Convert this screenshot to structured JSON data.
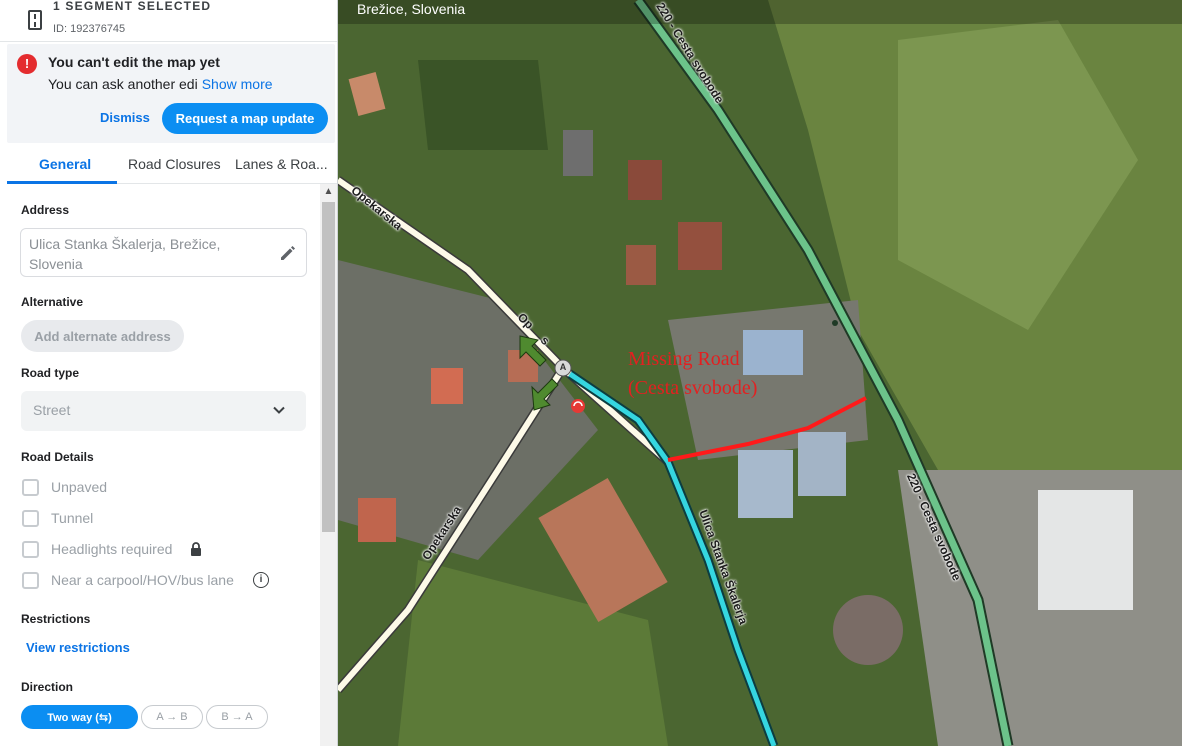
{
  "segment_header": {
    "title": "1 SEGMENT SELECTED",
    "id_text": "ID: 192376745"
  },
  "alert": {
    "icon": "!",
    "title": "You can't edit the map yet",
    "body": "You can ask another edi",
    "more_link": "Show more",
    "dismiss_label": "Dismiss",
    "request_label": "Request a map update"
  },
  "tabs": {
    "general": "General",
    "closures": "Road Closures",
    "lanes": "Lanes & Roa..."
  },
  "form": {
    "address_label": "Address",
    "address_value": "Ulica Stanka Škalerja, Brežice, Slovenia",
    "alternative_label": "Alternative",
    "alternative_button": "Add alternate address",
    "road_type_label": "Road type",
    "road_type_value": "Street",
    "road_details_label": "Road Details",
    "details": [
      "Unpaved",
      "Tunnel",
      "Headlights required",
      "Near a carpool/HOV/bus lane"
    ],
    "restrictions_label": "Restrictions",
    "view_restrictions": "View restrictions",
    "direction_label": "Direction",
    "direction_options": [
      "Two way (⇆)",
      "A → B",
      "B → A"
    ],
    "direction_two_way_icon": "⇆"
  },
  "map": {
    "location": "Brežice, Slovenia",
    "annotation_line1": "Missing Road",
    "annotation_line2": "(Cesta svobode)",
    "road_labels": {
      "opekarska_top": "Opekarska",
      "opekarska_mid": "Op",
      "opekarska_mid_suffix": "s",
      "opekarska_bottom": "Opekarska",
      "cesta_top": "220 - Cesta svobode",
      "cesta_right": "220 - Cesta svobode",
      "selected_street": "Ulica Stanka Škalerja"
    },
    "node_label": "A",
    "colors": {
      "highway": "#6cc38a",
      "selected": "#35d6e0",
      "street": "#fdfae8",
      "missing_road": "#ff1a1a"
    }
  }
}
